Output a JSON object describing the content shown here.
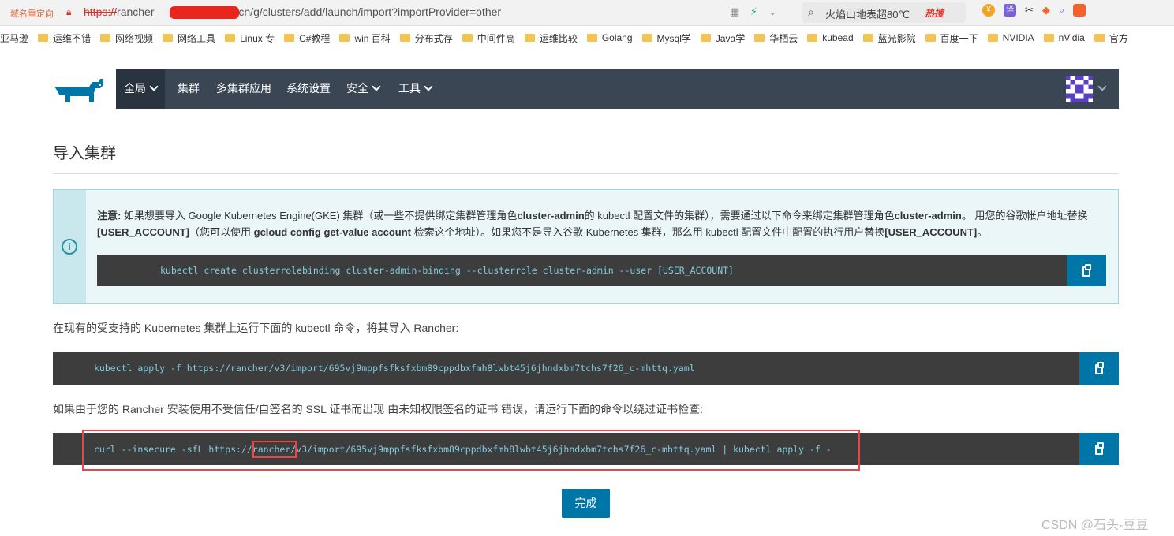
{
  "browser": {
    "redirect_label": "域名重定向",
    "url_protocol": "https://",
    "url_host_start": "rancher",
    "url_rest": ".cn/g/clusters/add/launch/import?importProvider=other",
    "search_text": "火焰山地表超80℃",
    "hot_label": "热搜"
  },
  "bookmarks": [
    {
      "label": "亚马逊"
    },
    {
      "label": "运维不错"
    },
    {
      "label": "网络视频"
    },
    {
      "label": "网络工具"
    },
    {
      "label": "Linux 专"
    },
    {
      "label": "C#教程"
    },
    {
      "label": "win 百科"
    },
    {
      "label": "分布式存"
    },
    {
      "label": "中间件高"
    },
    {
      "label": "运维比较"
    },
    {
      "label": "Golang"
    },
    {
      "label": "Mysql学"
    },
    {
      "label": "Java学"
    },
    {
      "label": "华栖云"
    },
    {
      "label": "kubead"
    },
    {
      "label": "蓝光影院"
    },
    {
      "label": "百度一下"
    },
    {
      "label": "NVIDIA"
    },
    {
      "label": "nVidia"
    },
    {
      "label": "官方"
    }
  ],
  "nav": {
    "global": "全局",
    "cluster": "集群",
    "multi_cluster_apps": "多集群应用",
    "settings": "系统设置",
    "security": "安全",
    "tools": "工具"
  },
  "page": {
    "title": "导入集群",
    "note_label": "注意:",
    "note_p1": " 如果想要导入 Google Kubernetes Engine(GKE) 集群（或一些不提供绑定集群管理角色",
    "note_b1": "cluster-admin",
    "note_p2": "的 kubectl 配置文件的集群），需要通过以下命令来绑定集群管理角色",
    "note_b2": "cluster-admin",
    "note_p3": "。 用您的谷歌帐户地址替换 ",
    "note_b3": "[USER_ACCOUNT]",
    "note_p4": "（您可以使用 ",
    "note_b4": "gcloud config get-value account",
    "note_p5": " 检索这个地址）。如果您不是导入谷歌 Kubernetes 集群，那么用 kubectl 配置文件中配置的执行用户替换",
    "note_b5": "[USER_ACCOUNT]",
    "note_p6": "。",
    "cmd_binding": "kubectl create clusterrolebinding cluster-admin-binding --clusterrole cluster-admin --user [USER_ACCOUNT]",
    "para_import": "在现有的受支持的 Kubernetes 集群上运行下面的 kubectl 命令，将其导入 Rancher:",
    "cmd_import": "kubectl apply -f https://rancher/v3/import/695vj9mppfsfksfxbm89cppdbxfmh8lwbt45j6jhndxbm7tchs7f26_c-mhttq.yaml",
    "para_insecure": "如果由于您的 Rancher 安装使用不受信任/自签名的 SSL 证书而出现 由未知权限签名的证书 错误，请运行下面的命令以绕过证书检查:",
    "cmd_insecure": "curl --insecure -sfL https://rancher/v3/import/695vj9mppfsfksfxbm89cppdbxfmh8lwbt45j6jhndxbm7tchs7f26_c-mhttq.yaml | kubectl apply -f -",
    "done_button": "完成"
  },
  "watermark": "CSDN @石头-豆豆",
  "colors": {
    "nav_bg": "#3b4655",
    "accent": "#0075a8",
    "code_bg": "#3d3d3d",
    "code_fg": "#7fcde0",
    "note_bg": "#eaf6f8",
    "annotation_red": "#e64848"
  }
}
